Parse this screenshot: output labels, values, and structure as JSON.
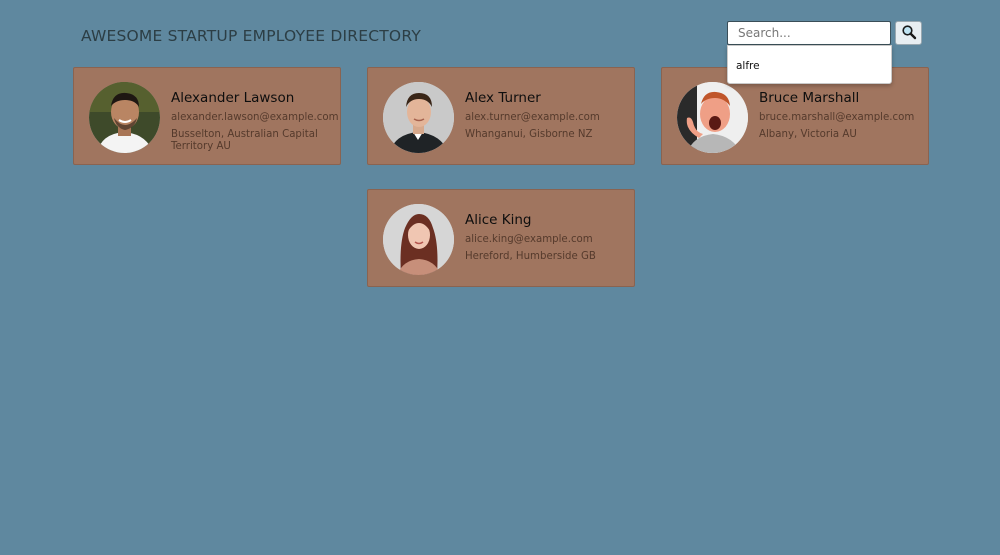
{
  "header": {
    "title": "AWESOME STARTUP EMPLOYEE DIRECTORY"
  },
  "search": {
    "placeholder": "Search...",
    "value": "",
    "button_icon": "magnifying-glass-icon",
    "suggestions": [
      "alfre"
    ]
  },
  "employees": [
    {
      "name": "Alexander Lawson",
      "email": "alexander.lawson@example.com",
      "location": "Busselton, Australian Capital Territory AU"
    },
    {
      "name": "Alex Turner",
      "email": "alex.turner@example.com",
      "location": "Whanganui, Gisborne NZ"
    },
    {
      "name": "Bruce Marshall",
      "email": "bruce.marshall@example.com",
      "location": "Albany, Victoria AU"
    },
    {
      "name": "Alice King",
      "email": "alice.king@example.com",
      "location": "Hereford, Humberside GB"
    }
  ],
  "colors": {
    "background": "#5f889f",
    "card": "#a0755f",
    "card_border": "#8a6350"
  }
}
